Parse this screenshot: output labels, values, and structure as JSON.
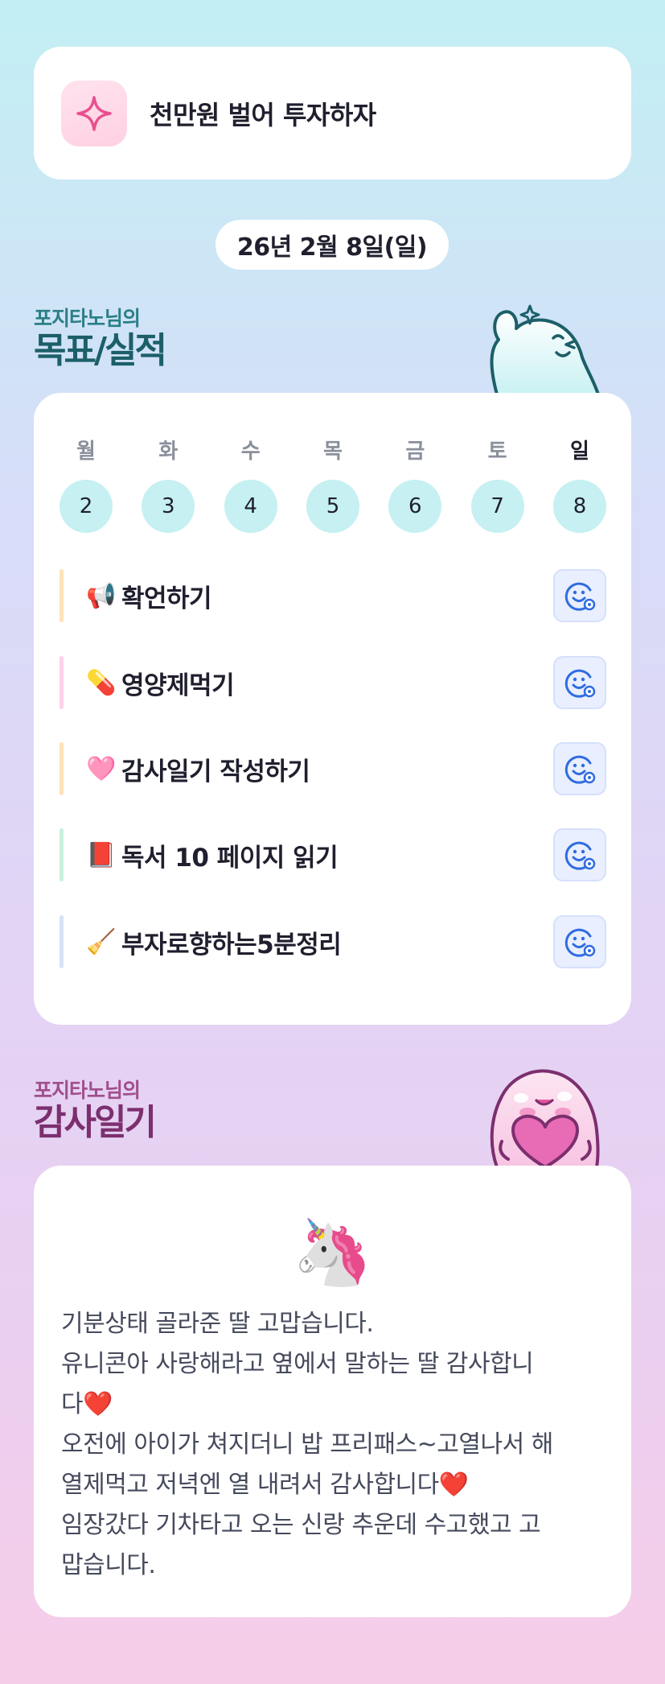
{
  "goal": {
    "text": "천만원 벌어 투자하자",
    "icon": "sparkle-icon"
  },
  "date": "26년 2월 8일(일)",
  "record_section": {
    "subtitle": "포지타노님의",
    "title": "목표/실적"
  },
  "week": {
    "days": [
      {
        "label": "월",
        "num": "2"
      },
      {
        "label": "화",
        "num": "3"
      },
      {
        "label": "수",
        "num": "4"
      },
      {
        "label": "목",
        "num": "5"
      },
      {
        "label": "금",
        "num": "6"
      },
      {
        "label": "토",
        "num": "7"
      },
      {
        "label": "일",
        "num": "8"
      }
    ],
    "active_day": "일"
  },
  "tasks": [
    {
      "emoji": "📢",
      "label": "확언하기",
      "bar_color": "#ffe2b8"
    },
    {
      "emoji": "💊",
      "label": " 영양제먹기",
      "bar_color": "#ffd1ea"
    },
    {
      "emoji": "🩷",
      "label": " 감사일기 작성하기",
      "bar_color": "#ffe2b8"
    },
    {
      "emoji": "📕",
      "label": " 독서 10 페이지 읽기",
      "bar_color": "#c8f0dc"
    },
    {
      "emoji": "🧹",
      "label": "부자로향하는5분정리",
      "bar_color": "#d8e2f5"
    }
  ],
  "diary_section": {
    "subtitle": "포지타노님의",
    "title": "감사일기"
  },
  "diary": {
    "emoji": "🦄",
    "text": "기분상태 골라준 딸 고맙습니다.\n유니콘아 사랑해라고 옆에서 말하는 딸 감사합니\n다❤️\n오전에 아이가 쳐지더니 밥 프리패스~고열나서 해\n열제먹고 저녁엔 열 내려서 감사합니다❤️\n임장갔다 기차타고 오는 신랑 추운데 수고했고 고\n맙습니다."
  }
}
